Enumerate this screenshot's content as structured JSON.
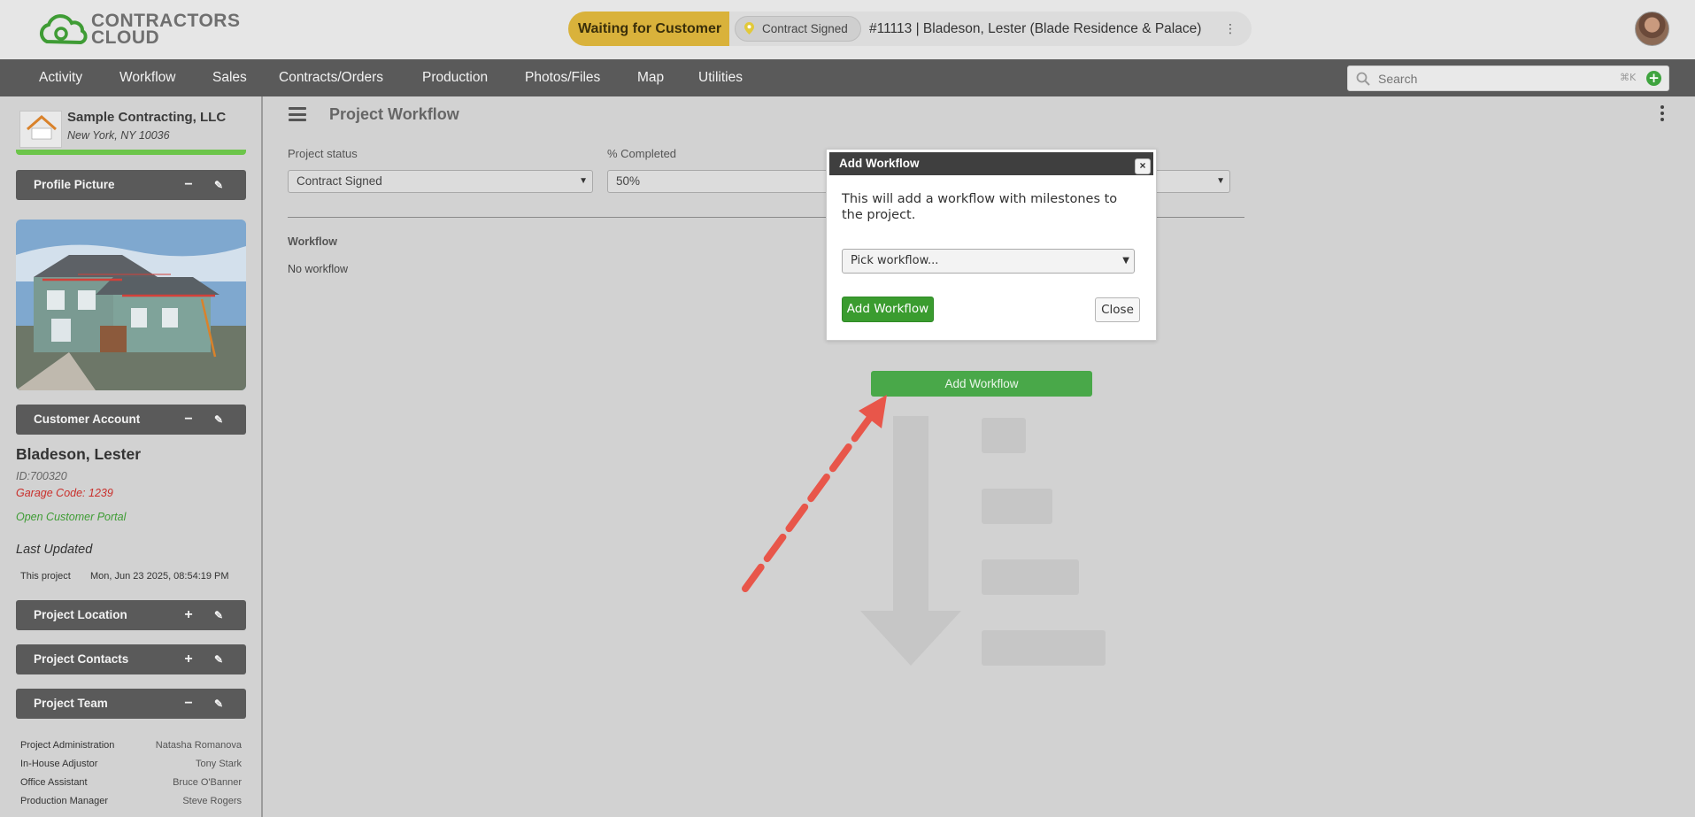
{
  "header": {
    "logo_text_line1": "CONTRACTORS",
    "logo_text_line2": "CLOUD",
    "status_label": "Waiting for Customer",
    "contract_chip": "Contract Signed",
    "project_title": "#11113 | Bladeson, Lester (Blade Residence & Palace)"
  },
  "nav": {
    "items": [
      "Activity",
      "Workflow",
      "Sales",
      "Contracts/Orders",
      "Production",
      "Photos/Files",
      "Map",
      "Utilities"
    ],
    "search_placeholder": "Search",
    "search_shortcut": "⌘K"
  },
  "sidebar": {
    "company_name": "Sample Contracting, LLC",
    "company_location": "New York, NY 10036",
    "company_logo_text": "Sample Contracting",
    "profile_picture": "Profile Picture",
    "customer_account": "Customer Account",
    "customer_name": "Bladeson, Lester",
    "customer_id": "ID:700320",
    "garage_code": "Garage Code: 1239",
    "portal_link": "Open Customer Portal",
    "last_updated_label": "Last Updated",
    "this_project_label": "This project",
    "this_project_date": "Mon, Jun 23 2025, 08:54:19 PM",
    "project_location": "Project Location",
    "project_contacts": "Project Contacts",
    "project_team": "Project Team",
    "team": [
      {
        "role": "Project Administration",
        "name": "Natasha Romanova"
      },
      {
        "role": "In-House Adjustor",
        "name": "Tony Stark"
      },
      {
        "role": "Office Assistant",
        "name": "Bruce O'Banner"
      },
      {
        "role": "Production Manager",
        "name": "Steve Rogers"
      }
    ]
  },
  "main": {
    "title": "Project Workflow",
    "project_status_label": "Project status",
    "project_status_value": "Contract Signed",
    "completed_label": "% Completed",
    "completed_value": "50%",
    "workflow_label": "Workflow",
    "no_workflow": "No workflow",
    "add_workflow_button": "Add Workflow"
  },
  "modal": {
    "title": "Add Workflow",
    "close_x": "×",
    "text": "This will add a workflow with milestones to the project.",
    "select_placeholder": "Pick workflow...",
    "add_button": "Add Workflow",
    "close_button": "Close"
  },
  "colors": {
    "status_yellow": "#d9b23b",
    "nav_bg": "#5a5a5a",
    "green": "#3a9c2f",
    "arrow": "#e8564a"
  }
}
